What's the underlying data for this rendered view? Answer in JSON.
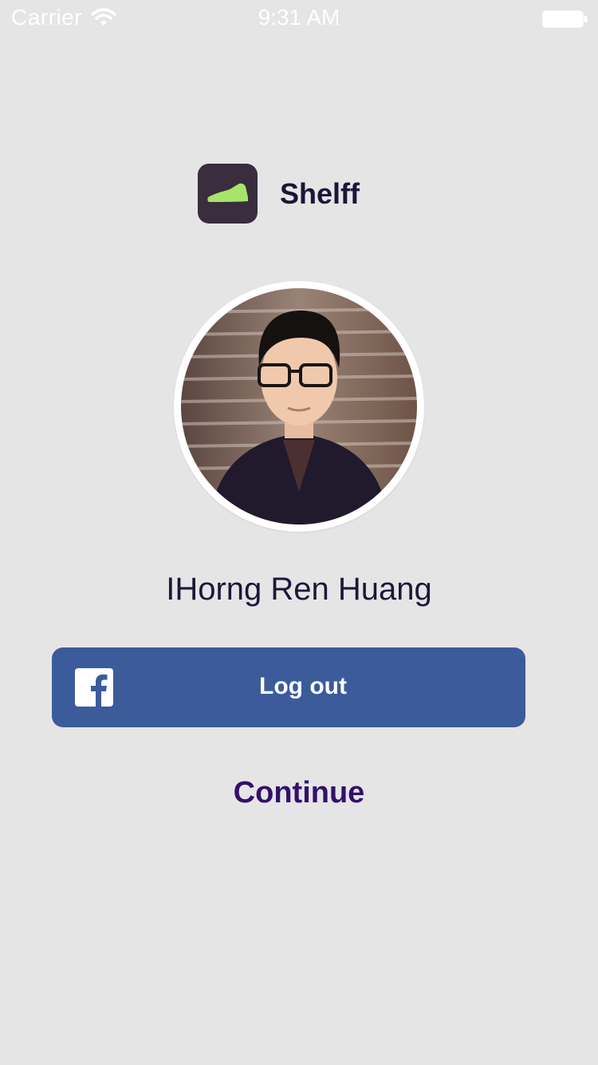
{
  "status_bar": {
    "carrier": "Carrier",
    "time": "9:31 AM",
    "wifi_icon": "wifi-icon",
    "battery_icon": "battery-icon"
  },
  "app": {
    "name": "Shelff",
    "logo_icon": "sneaker-icon",
    "logo_background": "#3a2d3e",
    "logo_color": "#a8e36a"
  },
  "profile": {
    "name": "IHorng Ren Huang",
    "avatar": "profile-photo"
  },
  "actions": {
    "logout_label": "Log out",
    "logout_icon": "facebook-icon",
    "logout_color": "#3b5b9b",
    "continue_label": "Continue",
    "continue_color": "#33106b"
  },
  "colors": {
    "background": "#e5e5e6",
    "text": "#1d1838"
  }
}
